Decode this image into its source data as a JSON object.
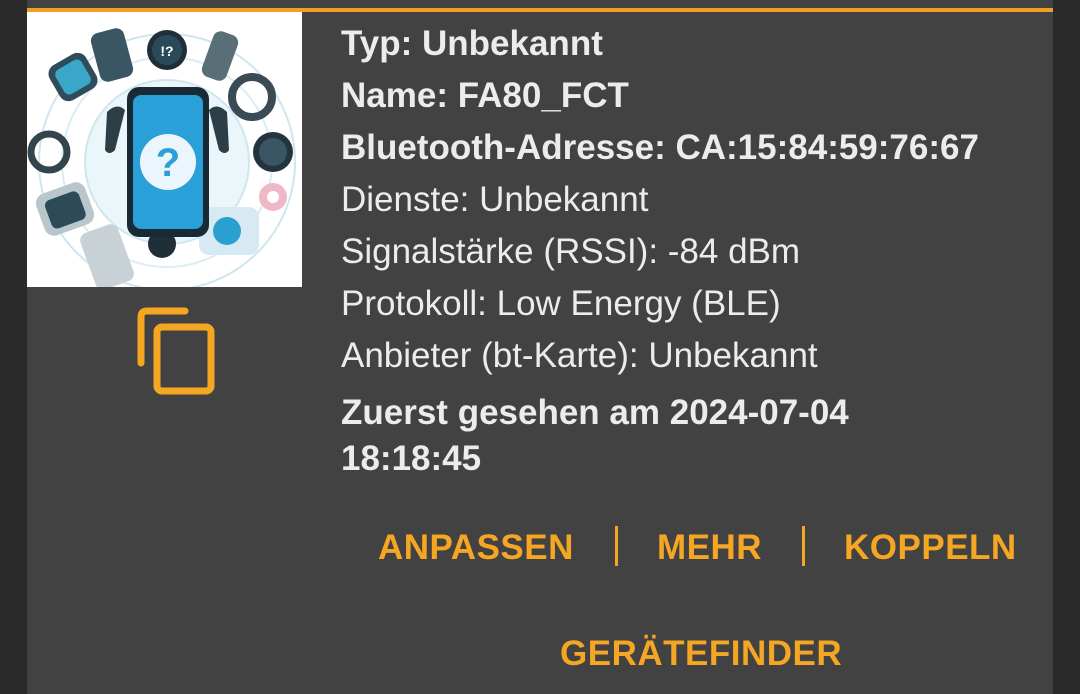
{
  "device": {
    "type_line": "Typ: Unbekannt",
    "name_line": "Name: FA80_FCT",
    "address_line": "Bluetooth-Adresse: CA:15:84:59:76:67",
    "services_line": "Dienste: Unbekannt",
    "rssi_line": "Signalstärke (RSSI): -84 dBm",
    "protocol_line": "Protokoll: Low Energy (BLE)",
    "vendor_line": "Anbieter (bt-Karte): Unbekannt",
    "first_seen_line": "Zuerst gesehen am 2024-07-04 18:18:45"
  },
  "actions": {
    "customize": "ANPASSEN",
    "more": "MEHR",
    "pair": "KOPPELN",
    "device_finder": "GERÄTEFINDER"
  },
  "image": {
    "badge_text": "!?",
    "icon": "unknown-device-phone-question-icon"
  },
  "colors": {
    "accent": "#f5a623",
    "card_background": "#424242",
    "text": "#ececec"
  }
}
